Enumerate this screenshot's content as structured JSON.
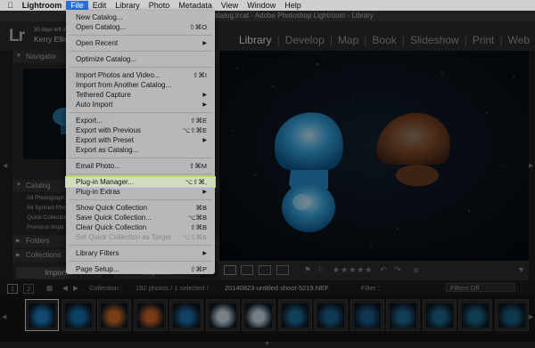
{
  "menubar": {
    "app_name": "Lightroom",
    "items": [
      "File",
      "Edit",
      "Library",
      "Photo",
      "Metadata",
      "View",
      "Window",
      "Help"
    ],
    "active": "File"
  },
  "window": {
    "title": "catalog.lrcat - Adobe Photoshop Lightroom - Library"
  },
  "identity": {
    "logo": "Lr",
    "trial_text": "30 days left in...",
    "user_name": "Kerry Ellis"
  },
  "modules": [
    "Library",
    "Develop",
    "Map",
    "Book",
    "Slideshow",
    "Print",
    "Web"
  ],
  "left_panel": {
    "navigator_label": "Navigator",
    "catalog_label": "Catalog",
    "catalog_rows": [
      "All Photograph",
      "All Synced Pho",
      "Quick Collection",
      "Previous Impo"
    ],
    "folders_label": "Folders",
    "collections_label": "Collections",
    "import_button": "Import...",
    "export_button": "Export..."
  },
  "file_menu": {
    "items": [
      {
        "label": "New Catalog...",
        "shortcut": ""
      },
      {
        "label": "Open Catalog...",
        "shortcut": "⇧⌘O"
      },
      {
        "sep": true
      },
      {
        "label": "Open Recent",
        "submenu": true
      },
      {
        "sep": true
      },
      {
        "label": "Optimize Catalog...",
        "shortcut": ""
      },
      {
        "sep": true
      },
      {
        "label": "Import Photos and Video...",
        "shortcut": "⇧⌘I"
      },
      {
        "label": "Import from Another Catalog...",
        "shortcut": ""
      },
      {
        "label": "Tethered Capture",
        "submenu": true
      },
      {
        "label": "Auto Import",
        "submenu": true
      },
      {
        "sep": true
      },
      {
        "label": "Export...",
        "shortcut": "⇧⌘E"
      },
      {
        "label": "Export with Previous",
        "shortcut": "⌥⇧⌘E"
      },
      {
        "label": "Export with Preset",
        "submenu": true
      },
      {
        "label": "Export as Catalog...",
        "shortcut": ""
      },
      {
        "sep": true
      },
      {
        "label": "Email Photo...",
        "shortcut": "⇧⌘M"
      },
      {
        "sep": true
      },
      {
        "label": "Plug-in Manager...",
        "shortcut": "⌥⇧⌘,",
        "highlighted": true
      },
      {
        "label": "Plug-in Extras",
        "submenu": true
      },
      {
        "sep": true
      },
      {
        "label": "Show Quick Collection",
        "shortcut": "⌘B"
      },
      {
        "label": "Save Quick Collection...",
        "shortcut": "⌥⌘B"
      },
      {
        "label": "Clear Quick Collection",
        "shortcut": "⇧⌘B"
      },
      {
        "label": "Set Quick Collection as Target",
        "shortcut": "⌥⇧⌘B",
        "disabled": true
      },
      {
        "sep": true
      },
      {
        "label": "Library Filters",
        "submenu": true
      },
      {
        "sep": true
      },
      {
        "label": "Page Setup...",
        "shortcut": "⇧⌘P"
      },
      {
        "label": "Printer...",
        "shortcut": "⌘P"
      }
    ]
  },
  "filmstrip_bar": {
    "page_1": "1",
    "page_2": "2",
    "source_label": "Collection :",
    "count": "182 photos / 1 selected /",
    "filename": "20140823-untitled shoot-5219.NEF",
    "filter_label": "Filter :",
    "filter_value": "Filters Off"
  },
  "filmstrip": {
    "thumbs": [
      "#1e7fc4",
      "#1872b4",
      "#d06a2a",
      "#cc6427",
      "#1e6ea9",
      "#cfdfe9",
      "#c9dae8",
      "#1c6f99",
      "#1b6596",
      "#1b5f8e",
      "#1e6c95",
      "#1c6a8f",
      "#1a6a8a",
      "#196385"
    ]
  },
  "colors": {
    "accent": "#2a6fd6",
    "highlight_outline": "#b8e35a",
    "jelly_blue": "#3aa7e0",
    "jelly_orange": "#e0742a"
  }
}
